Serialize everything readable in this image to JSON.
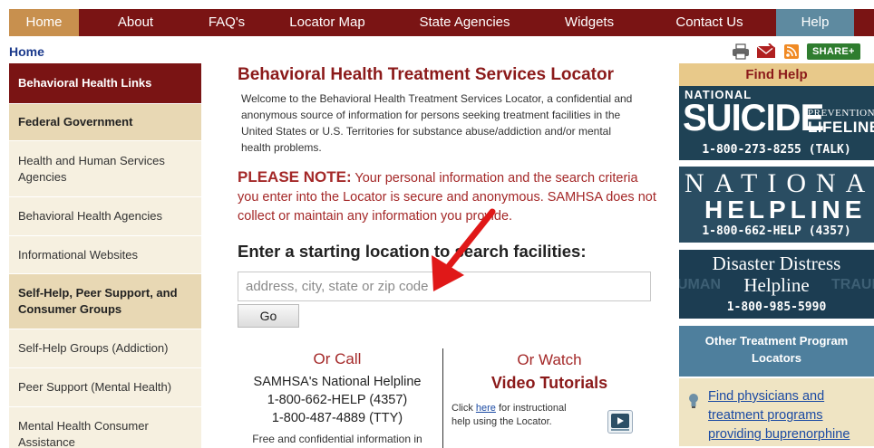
{
  "nav": {
    "items": [
      {
        "label": "Home"
      },
      {
        "label": "About"
      },
      {
        "label": "FAQ's"
      },
      {
        "label": "Locator Map"
      },
      {
        "label": "State Agencies"
      },
      {
        "label": "Widgets"
      },
      {
        "label": "Contact Us"
      },
      {
        "label": "Help"
      }
    ]
  },
  "breadcrumb": "Home",
  "toolbar": {
    "share_label": "SHARE+",
    "icons": [
      "print-icon",
      "email-icon",
      "rss-icon"
    ]
  },
  "sidebar": {
    "items": [
      {
        "label": "Behavioral Health Links"
      },
      {
        "label": "Federal Government"
      },
      {
        "label": "Health and Human Services Agencies"
      },
      {
        "label": "Behavioral Health Agencies"
      },
      {
        "label": "Informational Websites"
      },
      {
        "label": "Self-Help, Peer Support, and Consumer Groups"
      },
      {
        "label": "Self-Help Groups (Addiction)"
      },
      {
        "label": "Peer Support (Mental Health)"
      },
      {
        "label": "Mental Health Consumer Assistance"
      }
    ]
  },
  "main": {
    "title": "Behavioral Health Treatment Services Locator",
    "intro": "Welcome to the Behavioral Health Treatment Services Locator, a confidential and anonymous source of information for persons seeking treatment facilities in the United States or U.S. Territories for substance abuse/addiction and/or mental health problems.",
    "note_label": "PLEASE NOTE:",
    "note_text": " Your personal information and the search criteria you enter into the Locator is secure and anonymous. SAMHSA does not collect or maintain any information you provide.",
    "search_heading": "Enter a starting location to search facilities:",
    "search_placeholder": "address, city, state or zip code",
    "search_value": "",
    "go_label": "Go"
  },
  "call": {
    "title": "Or Call",
    "line1": "SAMHSA's National Helpline",
    "line2": "1-800-662-HELP (4357)",
    "line3": "1-800-487-4889 (TTY)",
    "line4": "Free and confidential information in"
  },
  "watch": {
    "title": "Or Watch",
    "subtitle": "Video Tutorials",
    "text_before": "Click ",
    "link": "here",
    "text_after": " for instructional help using the Locator."
  },
  "right": {
    "find_help": "Find Help",
    "suicide": {
      "national": "NATIONAL",
      "suicide": "SUICIDE",
      "prevention": "PREVENTION",
      "lifeline": "LIFELINE",
      "phone": "1-800-273-8255 (TALK)"
    },
    "helpline": {
      "national": "NATIONAL",
      "helpline": "HELPLINE",
      "phone": "1-800-662-HELP (4357)"
    },
    "disaster": {
      "line1": "Disaster Distress",
      "line2": "Helpline",
      "phone": "1-800-985-5990",
      "watermark_left": "UMAN",
      "watermark_right": "TRAUM"
    },
    "other_locators": "Other Treatment Program Locators",
    "bup_link": "Find physicians and treatment programs providing buprenorphine"
  },
  "colors": {
    "nav_bg": "#7a1414",
    "nav_home": "#c8904e",
    "nav_help": "#5e8aa0",
    "title_red": "#8b1a1a",
    "link_blue": "#1b4aa3"
  }
}
